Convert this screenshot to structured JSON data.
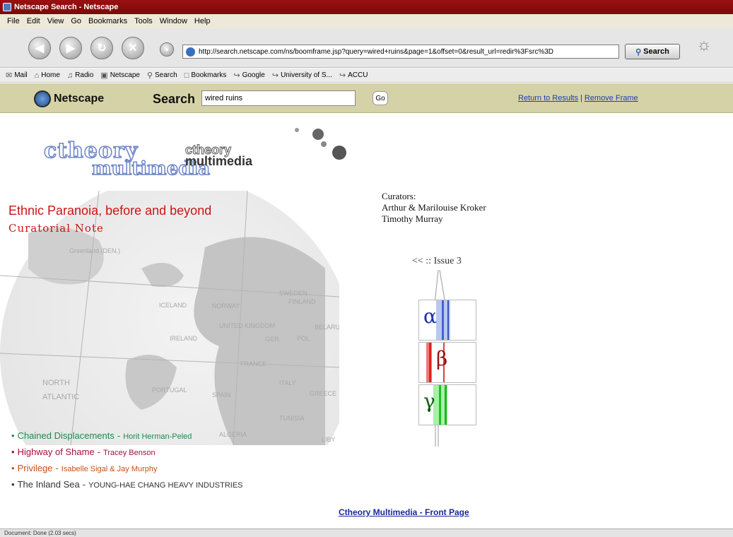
{
  "window": {
    "title": "Netscape Search - Netscape"
  },
  "menu": [
    "File",
    "Edit",
    "View",
    "Go",
    "Bookmarks",
    "Tools",
    "Window",
    "Help"
  ],
  "nav": {
    "url": "http://search.netscape.com/ns/boomframe.jsp?query=wired+ruins&page=1&offset=0&result_url=redir%3Fsrc%3D",
    "search_label": "Search"
  },
  "personal_toolbar": [
    "Mail",
    "Home",
    "Radio",
    "Netscape",
    "Search",
    "Bookmarks",
    "Google",
    "University of S...",
    "ACCU"
  ],
  "ns_bar": {
    "logo": "Netscape",
    "search_label": "Search",
    "query": "wired ruins",
    "go": "Go",
    "return_link": "Return to Results",
    "separator": "|",
    "remove_link": "Remove Frame"
  },
  "page": {
    "logo_big_top": "ctheory",
    "logo_big_bottom": "multimedia",
    "logo_small_top": "ctheory",
    "logo_small_bottom": "multimedia",
    "title": "Ethnic Paranoia, before and beyond",
    "subtitle": "Curatorial Note",
    "curators_label": "Curators:",
    "curator_1": "Arthur & Marilouise Kroker",
    "curator_2": "Timothy Murray",
    "issue": "<< :: Issue 3",
    "greek": [
      "α",
      "β",
      "γ"
    ],
    "map_labels": [
      "Greenland (DEN.)",
      "ICELAND",
      "NORWAY",
      "SWEDEN",
      "FINLAND",
      "UNITED KINGDOM",
      "IRELAND",
      "GER.",
      "POL.",
      "BELARUS",
      "FRANCE",
      "PORTUGAL",
      "SPAIN",
      "ITALY",
      "GREECE",
      "TUNISIA",
      "ALGERIA",
      "LIBY",
      "NORTH",
      "ATLANTIC"
    ],
    "works": [
      {
        "title": "Chained Displacements",
        "author": "Horit Herman-Peled",
        "color": "#1f8a4c"
      },
      {
        "title": "Highway of Shame",
        "author": "Tracey Benson",
        "color": "#a0123a"
      },
      {
        "title": "Privilege",
        "author": "Isabelle Sigal & Jay Murphy",
        "color": "#c8501a"
      },
      {
        "title": "The Inland Sea",
        "author": "YOUNG-HAE CHANG HEAVY INDUSTRIES",
        "color": "#333333"
      }
    ],
    "dash": "-",
    "front_page": "Ctheory Multimedia - Front Page"
  },
  "status": {
    "text": "Document: Done (2.03 secs)"
  },
  "colors": {
    "title_bar": "#8a0c0c",
    "ns_bar": "#d6d2a7",
    "accent_red": "#cc1515",
    "link": "#1a3fb5"
  }
}
